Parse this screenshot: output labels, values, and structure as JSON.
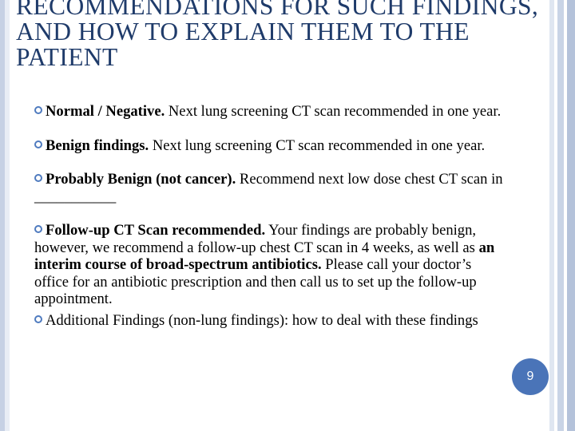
{
  "slide": {
    "title": "RECOMMENDATIONS FOR SUCH FINDINGS, AND HOW TO EXPLAIN THEM TO THE PATIENT",
    "page_number": "9",
    "accent_color": "#4a74b8",
    "title_color": "#1f3b6a"
  },
  "bullets": [
    {
      "bold": "Normal / Negative.",
      "text": " Next lung screening CT scan recommended in one year."
    },
    {
      "bold": "Benign findings.",
      "text": "  Next lung screening CT scan recommended in one year."
    },
    {
      "bold": "Probably Benign (not cancer).",
      "text": "  Recommend next low dose chest CT scan in ___________"
    },
    {
      "bold": "Follow-up CT Scan recommended.",
      "text": "  Your findings are probably benign, however, we recommend a follow-up chest CT scan in 4 weeks, as well as ",
      "bold2": "an interim course of broad-spectrum antibiotics.",
      "text2": "  Please call your doctor’s office for an antibiotic prescription and then call us to set up the follow-up appointment."
    },
    {
      "text": "Additional Findings (non-lung findings): how to deal with these findings"
    }
  ],
  "icons": {
    "bullet": "ring-bullet-icon"
  }
}
